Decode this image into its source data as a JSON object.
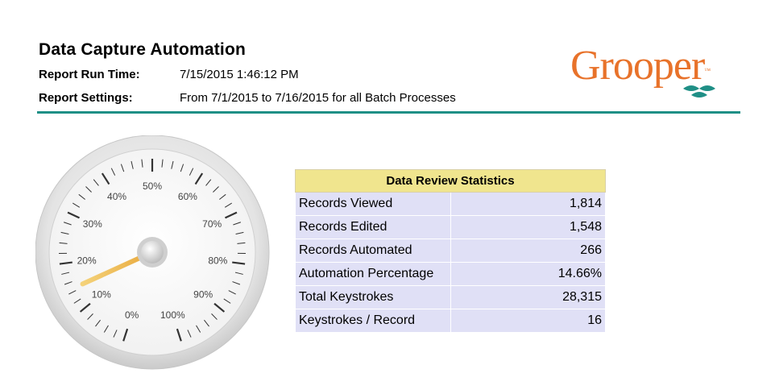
{
  "header": {
    "title": "Data Capture Automation",
    "run_time_label": "Report Run Time:",
    "run_time_value": "7/15/2015 1:46:12 PM",
    "settings_label": "Report Settings:",
    "settings_value": "From 7/1/2015 to 7/16/2015 for all Batch Processes"
  },
  "logo": {
    "text": "Grooper",
    "trademark": "™",
    "brand_color": "#e8722a",
    "accent_color": "#1f8f86"
  },
  "gauge": {
    "value_percent": 14.66,
    "tick_labels": [
      "0%",
      "10%",
      "20%",
      "30%",
      "40%",
      "50%",
      "60%",
      "70%",
      "80%",
      "90%",
      "100%"
    ]
  },
  "stats_table": {
    "title": "Data Review Statistics",
    "rows": [
      {
        "label": "Records Viewed",
        "value": "1,814"
      },
      {
        "label": "Records Edited",
        "value": "1,548"
      },
      {
        "label": "Records Automated",
        "value": "266"
      },
      {
        "label": "Automation Percentage",
        "value": "14.66%"
      },
      {
        "label": "Total Keystrokes",
        "value": "28,315"
      },
      {
        "label": "Keystrokes / Record",
        "value": "16"
      }
    ]
  }
}
